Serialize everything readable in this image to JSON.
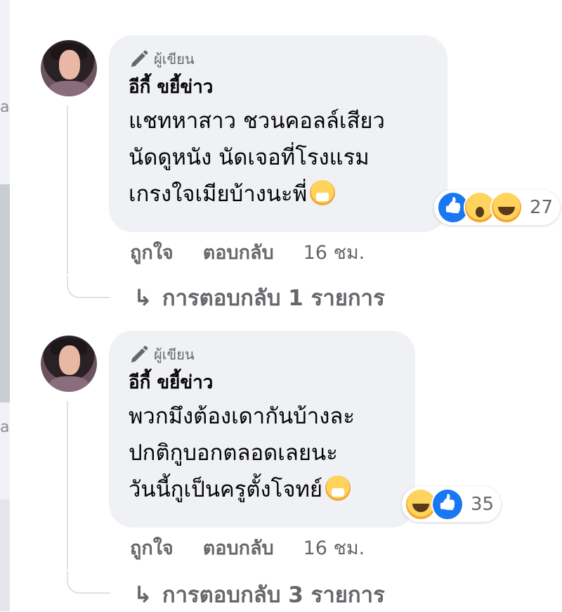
{
  "colors": {
    "bubble": "#eff1f5",
    "secondary_text": "#65676b",
    "primary_text": "#050505",
    "like_blue": "#1877f2",
    "emoji_yellow": "#ffd35c"
  },
  "edge": {
    "letters": [
      "a",
      "a"
    ]
  },
  "comments": [
    {
      "author_badge": "ผู้เขียน",
      "author_icon": "pen-icon",
      "author_name": "อีกี้ ขยี้ข่าว",
      "text": "แชทหาสาว ชวนคอลล์เสียว\nนัดดูหนัง นัดเจอที่โรงแรม\nเกรงใจเมียบ้างนะพี่",
      "inline_emoji": "face-with-hand-over-mouth-emoji",
      "reactions": [
        "like",
        "wow",
        "haha"
      ],
      "reaction_count": "27",
      "like_label": "ถูกใจ",
      "reply_label": "ตอบกลับ",
      "time": "16 ชม.",
      "view_replies": "การตอบกลับ 1 รายการ"
    },
    {
      "author_badge": "ผู้เขียน",
      "author_icon": "pen-icon",
      "author_name": "อีกี้ ขยี้ข่าว",
      "text": "พวกมึงต้องเดากันบ้างละ\nปกติกูบอกตลอดเลยนะ\nวันนี้กูเป็นครูตั้งโจทย์",
      "inline_emoji": "face-with-hand-over-mouth-emoji",
      "reactions": [
        "haha",
        "like"
      ],
      "reaction_count": "35",
      "like_label": "ถูกใจ",
      "reply_label": "ตอบกลับ",
      "time": "16 ชม.",
      "view_replies": "การตอบกลับ 3 รายการ"
    }
  ]
}
